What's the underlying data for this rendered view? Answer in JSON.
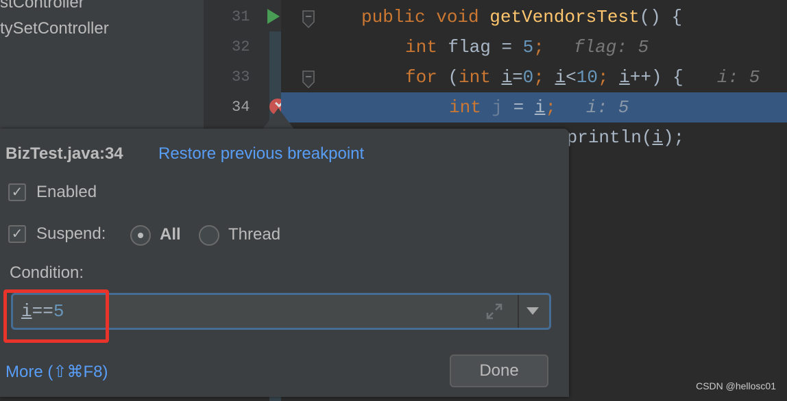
{
  "project_tree": [
    "stController",
    "tySetController"
  ],
  "gutter": {
    "lines": [
      "31",
      "32",
      "33",
      "34"
    ]
  },
  "code": {
    "l31": {
      "kw": "public void ",
      "fn": "getVendorsTest",
      "rest": "() {"
    },
    "l32": {
      "kw": "int ",
      "a": "flag = ",
      "num": "5",
      "b": ";",
      "hint": "flag: 5"
    },
    "l33": {
      "kw1": "for ",
      "a": "(",
      "kw2": "int ",
      "i1": "i",
      "b": "=",
      "n1": "0",
      "c": "; ",
      "i2": "i",
      "d": "<",
      "n2": "10",
      "e": "; ",
      "i3": "i",
      "f": "++) {",
      "hint": "i: 5"
    },
    "l34": {
      "kw": "int ",
      "j": "j",
      " eq": " = ",
      "i": "i",
      "semi": ";",
      "hint": "i: 5"
    },
    "l35": {
      "a": "System.out.println(",
      "i": "i",
      "b": ");"
    }
  },
  "popup": {
    "title": "BizTest.java:34",
    "restore_link": "Restore previous breakpoint",
    "enabled_label": "Enabled",
    "enabled": true,
    "suspend_label": "Suspend:",
    "suspend": true,
    "radio_all": "All",
    "radio_thread": "Thread",
    "selected": "All",
    "condition_label": "Condition:",
    "condition": {
      "var": "i",
      "op": "==",
      "val": "5"
    },
    "more_link": "More (⇧⌘F8)",
    "done": "Done"
  },
  "watermark": "CSDN @hellosc01",
  "colors": {
    "accent": "#589df6",
    "highlight": "#365880",
    "annotation": "#e8342a",
    "breakpoint": "#c75450"
  }
}
